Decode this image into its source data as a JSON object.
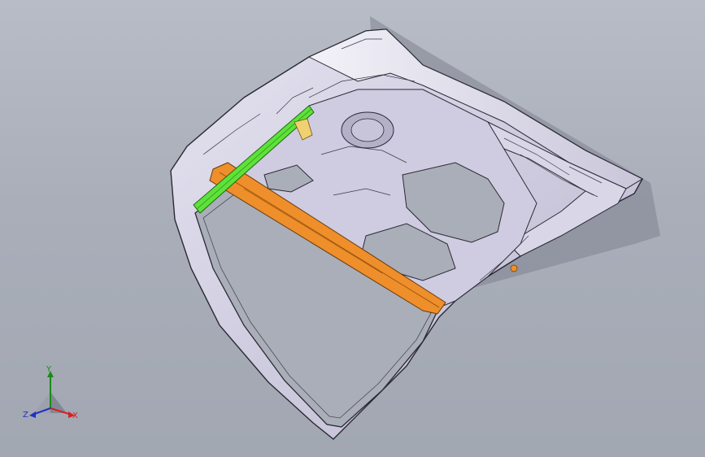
{
  "viewport": {
    "background_top": "#b8bcc6",
    "background_bottom": "#a2a7b2"
  },
  "model": {
    "name": "tailgate-inner-panel",
    "colors": {
      "panel": "#d6d4e4",
      "panel_shade": "#b7b3cc",
      "edge": "#2a2a33",
      "reinforcement_orange": "#ee8f2b",
      "reinforcement_green": "#5ee23a",
      "hinge_yellow": "#f0d070"
    }
  },
  "triad": {
    "x_label": "X",
    "y_label": "Y",
    "z_label": "Z",
    "x_color": "#d62020",
    "y_color": "#1a8a1a",
    "z_color": "#2030c8"
  }
}
